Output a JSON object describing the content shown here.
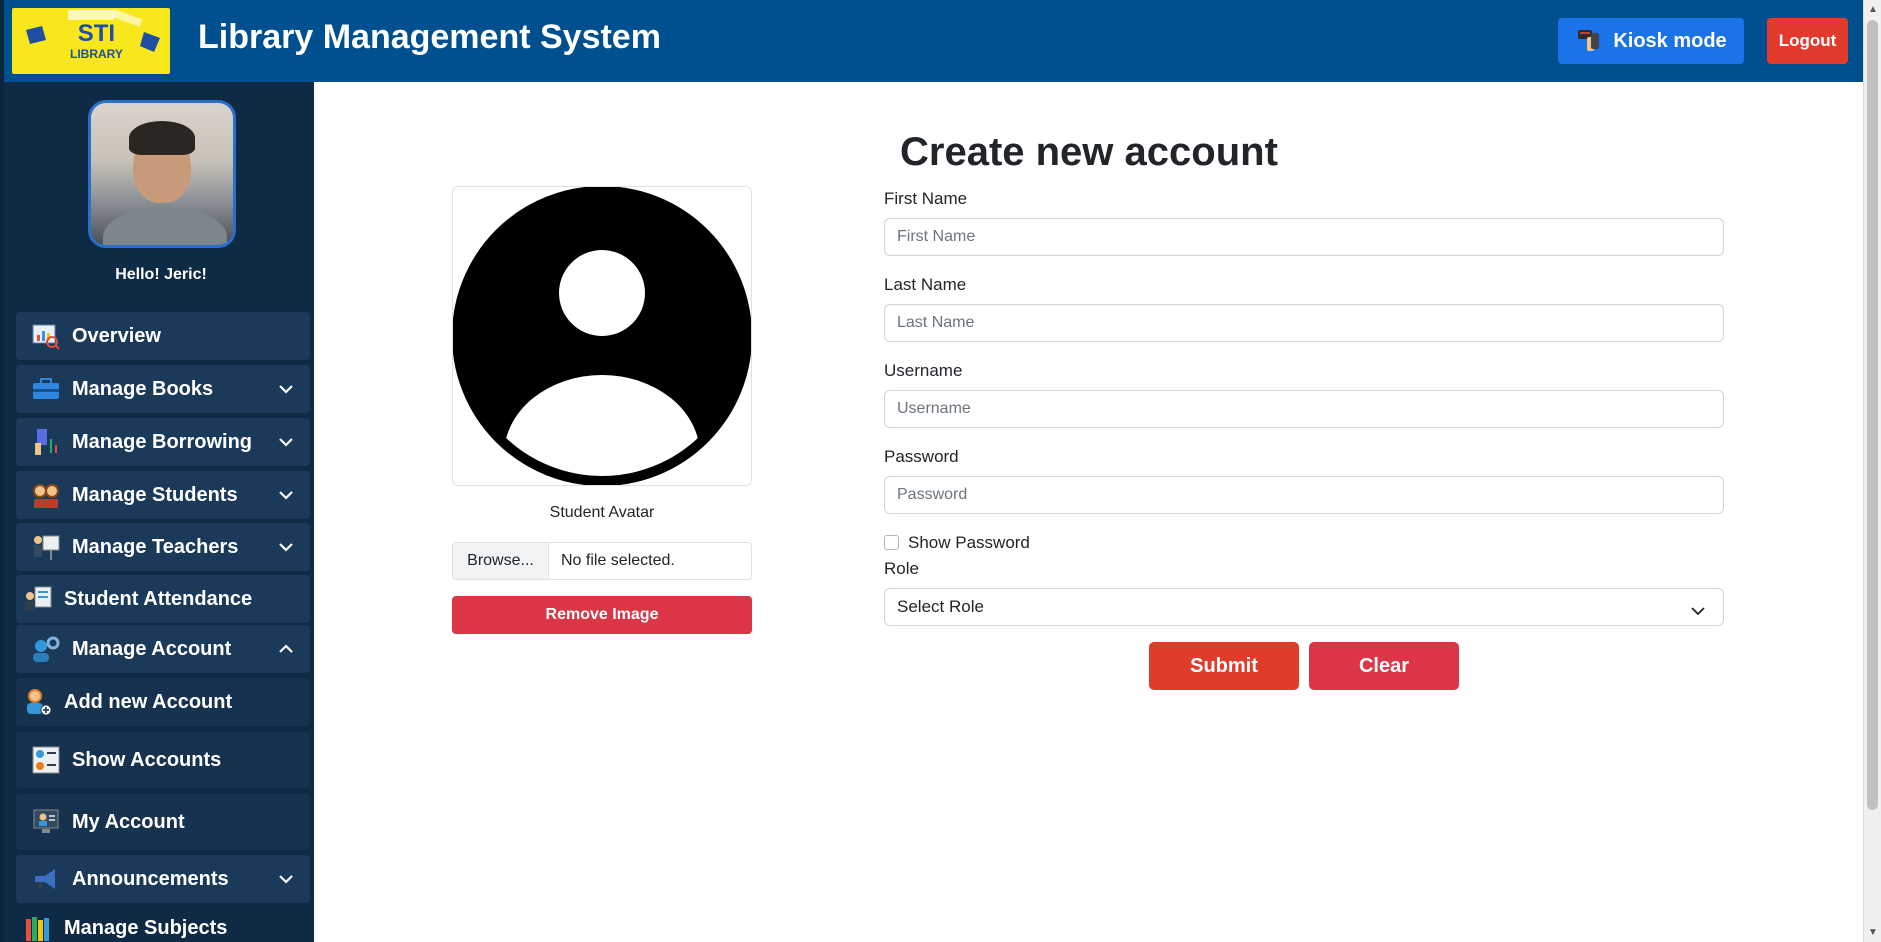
{
  "header": {
    "logo_line1": "STI",
    "logo_line2": "LIBRARY",
    "title": "Library Management System",
    "kiosk_label": "Kiosk mode",
    "logout_label": "Logout"
  },
  "sidebar": {
    "greeting": "Hello! Jeric!",
    "items": [
      {
        "label": "Overview",
        "icon": "chart-icon",
        "expanded": null
      },
      {
        "label": "Manage Books",
        "icon": "briefcase-icon",
        "expanded": false
      },
      {
        "label": "Manage Borrowing",
        "icon": "borrow-icon",
        "expanded": false
      },
      {
        "label": "Manage Students",
        "icon": "students-icon",
        "expanded": false
      },
      {
        "label": "Manage Teachers",
        "icon": "teacher-icon",
        "expanded": false
      },
      {
        "label": "Student Attendance",
        "icon": "attendance-icon",
        "expanded": null
      },
      {
        "label": "Manage Account",
        "icon": "account-gear-icon",
        "expanded": true
      },
      {
        "label": "Add new Account",
        "icon": "add-user-icon",
        "expanded": null
      },
      {
        "label": "Show Accounts",
        "icon": "accounts-list-icon",
        "expanded": null
      },
      {
        "label": "My Account",
        "icon": "my-account-icon",
        "expanded": null
      },
      {
        "label": "Announcements",
        "icon": "megaphone-icon",
        "expanded": false
      },
      {
        "label": "Manage Subjects",
        "icon": "books-icon",
        "expanded": null
      }
    ]
  },
  "avatar_panel": {
    "label": "Student Avatar",
    "browse_label": "Browse...",
    "file_status": "No file selected.",
    "remove_label": "Remove Image"
  },
  "form": {
    "title": "Create new account",
    "first_name": {
      "label": "First Name",
      "placeholder": "First Name",
      "value": ""
    },
    "last_name": {
      "label": "Last Name",
      "placeholder": "Last Name",
      "value": ""
    },
    "username": {
      "label": "Username",
      "placeholder": "Username",
      "value": ""
    },
    "password": {
      "label": "Password",
      "placeholder": "Password",
      "value": ""
    },
    "show_password_label": "Show Password",
    "show_password_checked": false,
    "role": {
      "label": "Role",
      "selected": "Select Role"
    },
    "submit_label": "Submit",
    "clear_label": "Clear"
  },
  "colors": {
    "header_bg": "#00508f",
    "sidebar_bg": "#0f2a45",
    "kiosk_btn": "#1a73e8",
    "logout_btn": "#e23b2e",
    "danger": "#dc3545",
    "submit_btn": "#e03c2a"
  }
}
